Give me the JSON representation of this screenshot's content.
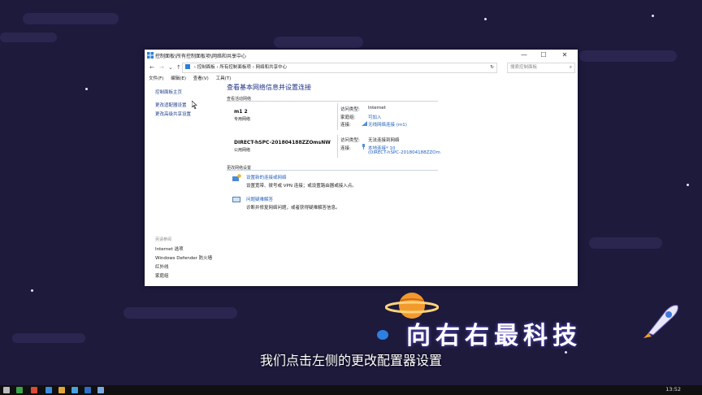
{
  "window": {
    "title": "控制面板\\所有控制面板项\\网络和共享中心",
    "controls": {
      "minimize": "—",
      "maximize": "☐",
      "close": "✕"
    }
  },
  "addressbar": {
    "back": "←",
    "forward": "→",
    "down": "⌄",
    "up": "↑",
    "breadcrumb": [
      "控制面板",
      "所有控制面板项",
      "网络和共享中心"
    ],
    "sep": "›",
    "refresh": "↻",
    "search_placeholder": "搜索控制面板"
  },
  "menubar": [
    "文件(F)",
    "编辑(E)",
    "查看(V)",
    "工具(T)"
  ],
  "sidebar": {
    "home": "控制面板主页",
    "links": [
      "更改适配器设置",
      "更改高级共享设置"
    ],
    "see_also_heading": "另请参阅",
    "see_also": [
      "Internet 选项",
      "Windows Defender 防火墙",
      "红外线",
      "家庭组"
    ]
  },
  "main": {
    "heading": "查看基本网络信息并设置连接",
    "active_section": "查看活动网络",
    "networks": [
      {
        "name": "m1  2",
        "category": "专用网络",
        "access_type_label": "访问类型:",
        "access_type": "Internet",
        "homegroup_label": "家庭组:",
        "homegroup": "可加入",
        "connection_label": "连接:",
        "connection": "无线网络连接 (m1)"
      },
      {
        "name": "DIRECT-hSPC-201804188ZZOmsNW",
        "category": "公用网络",
        "access_type_label": "访问类型:",
        "access_type": "无法连接到网络",
        "connection_label": "连接:",
        "connection": "本地连接* 10",
        "connection_line2": "(DIRECT-hSPC-201804188ZZOm"
      }
    ],
    "change_section": "更改网络设置",
    "tasks": [
      {
        "title": "设置新的连接或网络",
        "desc": "设置宽带、拨号或 VPN 连接；或设置路由器或接入点。"
      },
      {
        "title": "问题疑难解答",
        "desc": "诊断并修复网络问题，或者获得疑难解答信息。"
      }
    ]
  },
  "overlay": {
    "subtitle": "我们点击左侧的更改配置器设置",
    "brand": "向右右最科技"
  },
  "taskbar": {
    "time": "13:52"
  },
  "colors": {
    "background": "#1d1a3c",
    "link": "#1f5fbf",
    "heading": "#1e3287"
  }
}
